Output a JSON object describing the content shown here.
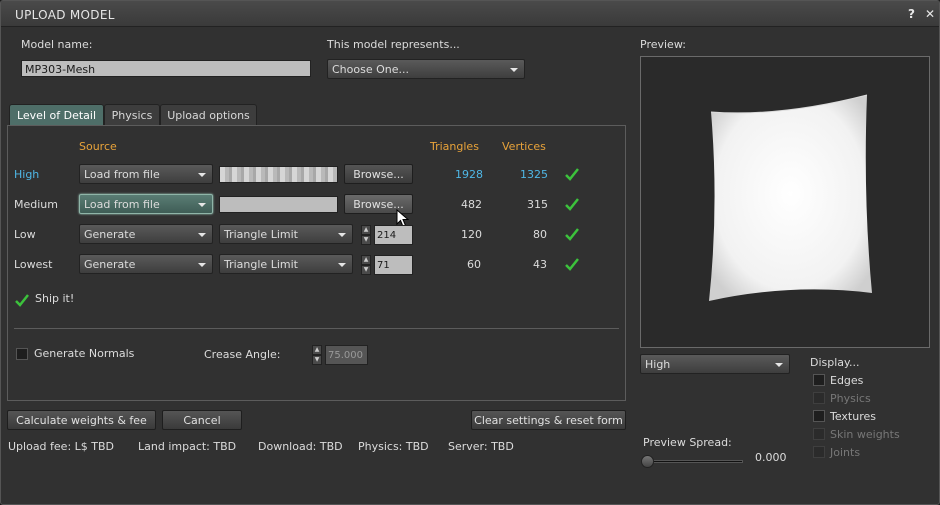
{
  "window": {
    "title": "UPLOAD MODEL",
    "help_label": "?",
    "close_label": "✕"
  },
  "model_name": {
    "label": "Model name:",
    "value": "MP303-Mesh"
  },
  "represents": {
    "label": "This model represents...",
    "value": "Choose One..."
  },
  "tabs": [
    {
      "label": "Level of Detail",
      "selected": true
    },
    {
      "label": "Physics",
      "selected": false
    },
    {
      "label": "Upload options",
      "selected": false
    }
  ],
  "lod": {
    "headers": {
      "source": "Source",
      "triangles": "Triangles",
      "vertices": "Vertices"
    },
    "rows": [
      {
        "name": "High",
        "source": "Load from file",
        "file": "",
        "browse": "Browse...",
        "triangles": "1928",
        "vertices": "1325"
      },
      {
        "name": "Medium",
        "source": "Load from file",
        "file": "",
        "browse": "Browse...",
        "triangles": "482",
        "vertices": "315"
      },
      {
        "name": "Low",
        "source": "Generate",
        "mode": "Triangle Limit",
        "limit": "214",
        "triangles": "120",
        "vertices": "80"
      },
      {
        "name": "Lowest",
        "source": "Generate",
        "mode": "Triangle Limit",
        "limit": "71",
        "triangles": "60",
        "vertices": "43"
      }
    ],
    "ship_it": "Ship it!",
    "generate_normals": "Generate Normals",
    "crease_angle_label": "Crease Angle:",
    "crease_angle_value": "75.000"
  },
  "buttons": {
    "calculate": "Calculate weights & fee",
    "cancel": "Cancel",
    "clear": "Clear settings & reset form"
  },
  "status": {
    "upload_fee": "Upload fee: L$ TBD",
    "land_impact": "Land impact: TBD",
    "download": "Download: TBD",
    "physics": "Physics: TBD",
    "server": "Server: TBD"
  },
  "preview": {
    "label": "Preview:",
    "lod_value": "High",
    "spread_label": "Preview Spread:",
    "spread_value": "0.000",
    "display_label": "Display...",
    "options": [
      {
        "label": "Edges",
        "enabled": true
      },
      {
        "label": "Physics",
        "enabled": false
      },
      {
        "label": "Textures",
        "enabled": true
      },
      {
        "label": "Skin weights",
        "enabled": false
      },
      {
        "label": "Joints",
        "enabled": false
      }
    ]
  },
  "colors": {
    "accent_orange": "#e8a33a",
    "accent_blue": "#4fb7e6",
    "check_green": "#3cc23c",
    "tab_selected": "#4e6e68"
  }
}
